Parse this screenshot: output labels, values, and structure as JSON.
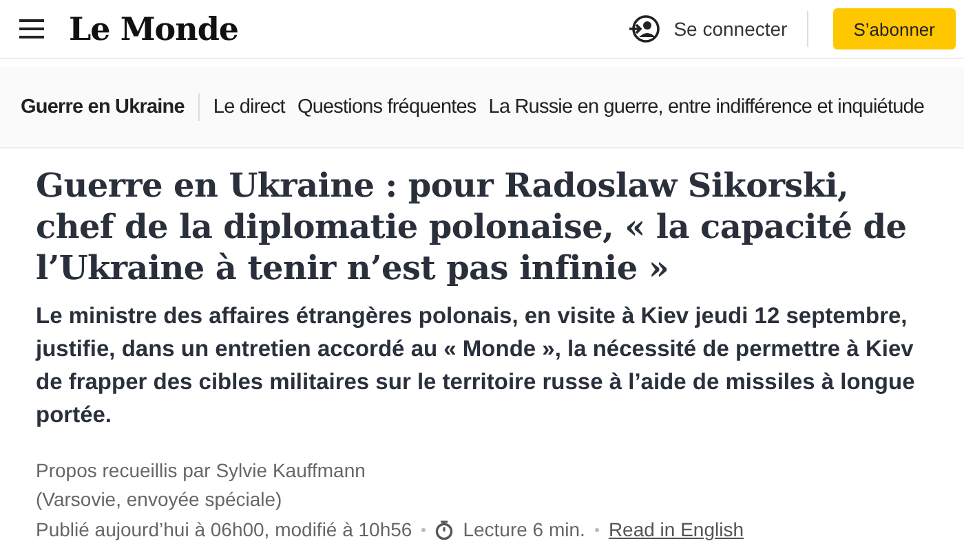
{
  "header": {
    "logo": "Le Monde",
    "login": "Se connecter",
    "subscribe": "S’abonner"
  },
  "nav": [
    {
      "label": "Guerre en Ukraine",
      "kind": "section"
    },
    {
      "label": "Le direct",
      "kind": "link"
    },
    {
      "label": "Questions fréquentes",
      "kind": "link"
    },
    {
      "label": "La Russie en guerre, entre indifférence et inquiétude",
      "kind": "link"
    }
  ],
  "article": {
    "title": "Guerre en Ukraine : pour Radoslaw Sikorski, chef de la diplomatie polonaise, « la capacité de l’Ukraine à tenir n’est pas infinie »",
    "standfirst": "Le ministre des affaires étrangères polonais, en visite à Kiev jeudi 12 septembre, justifie, dans un entretien accordé au « Monde », la nécessité de permettre à Kiev de frapper des cibles militaires sur le territoire russe à l’aide de missiles à longue portée.",
    "author": "Propos recueillis par Sylvie Kauffmann (Varsovie, envoyée spéciale)",
    "published": "Publié aujourd’hui à 06h00, modifié à 10h56",
    "reading_time": "Lecture 6 min.",
    "translation_link": "Read in English"
  }
}
